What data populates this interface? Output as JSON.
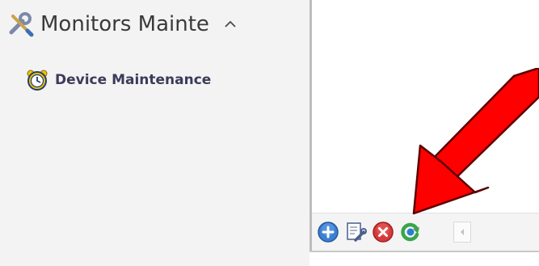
{
  "sidebar": {
    "title": "Monitors Mainten",
    "title_icon": "tools-icon",
    "collapse_icon": "chevron-up-icon",
    "items": [
      {
        "label": "Device Maintenance",
        "icon": "alarm-clock-icon"
      }
    ]
  },
  "toolbar": {
    "buttons": [
      {
        "name": "add-button",
        "icon": "plus-circle-icon",
        "color": "#3d7fd1"
      },
      {
        "name": "edit-button",
        "icon": "wrench-search-icon",
        "color": "#4a5f8a"
      },
      {
        "name": "delete-button",
        "icon": "delete-circle-icon",
        "color": "#d63a3a"
      },
      {
        "name": "refresh-button",
        "icon": "refresh-icon",
        "color": "#3aa54a"
      }
    ],
    "scroll_icon": "scroll-left-icon"
  },
  "annotation": {
    "icon": "red-arrow",
    "color": "#ff0000"
  },
  "colors": {
    "sidebar_bg": "#f3f3f3",
    "toolbar_bg": "#f4f4f4"
  }
}
